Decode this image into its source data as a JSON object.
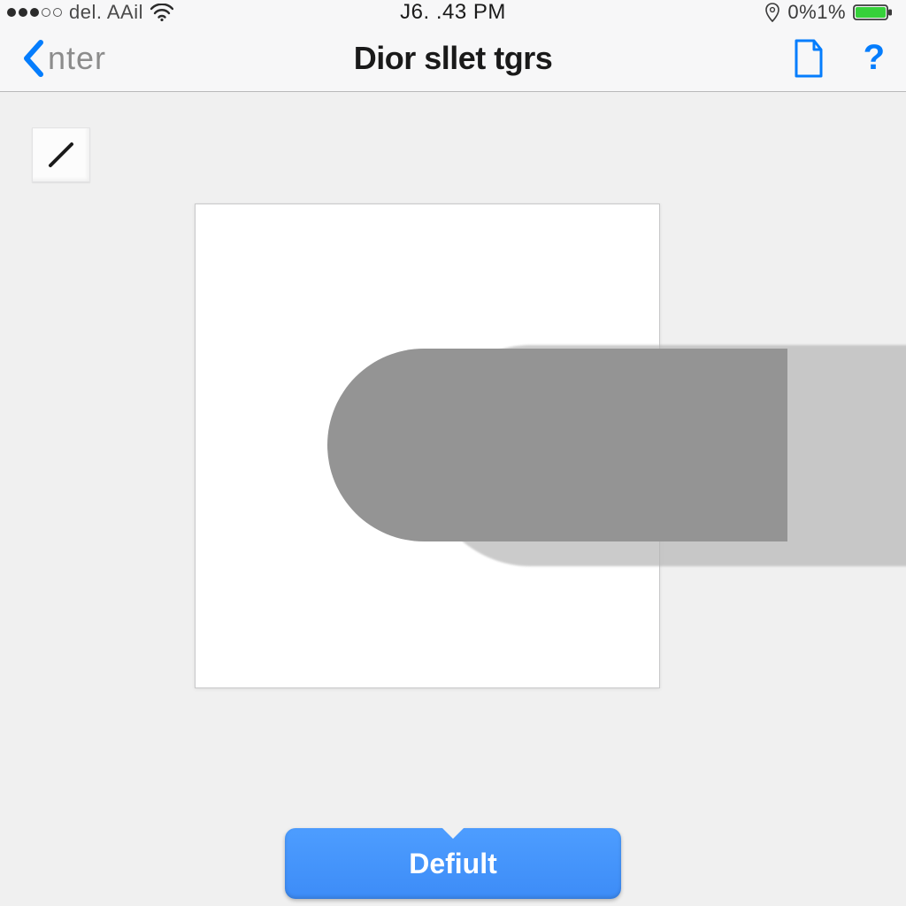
{
  "status_bar": {
    "carrier": "del. AAil",
    "time": "J6. .43 PM",
    "battery_pct": "0%1%"
  },
  "nav": {
    "back_label": "nter",
    "title": "Dior sllet tgrs",
    "icons": {
      "back": "chevron-left-icon",
      "document": "document-icon",
      "help_glyph": "?"
    }
  },
  "toolbar": {
    "pen_icon": "pen-icon"
  },
  "bottom_button": {
    "label": "Defiult"
  },
  "colors": {
    "accent": "#057dfd",
    "button_blue": "#3d8cf7",
    "canvas_border": "#c8c8c9",
    "bg": "#f0f0f0"
  }
}
